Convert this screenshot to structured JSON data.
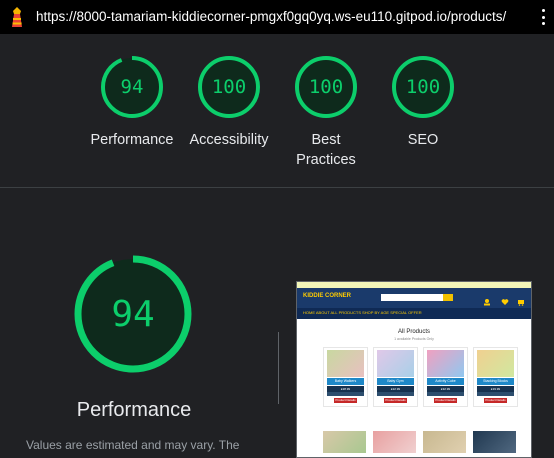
{
  "topbar": {
    "url": "https://8000-tamariam-kiddiecorner-pmgxf0gq0yq.ws-eu110.gitpod.io/products/"
  },
  "colors": {
    "good": "#0cce6b",
    "track": "#0a3a22",
    "background": "#202124"
  },
  "scores": [
    {
      "value": "94",
      "label": "Performance"
    },
    {
      "value": "100",
      "label": "Accessibility"
    },
    {
      "value": "100",
      "label": "Best Practices"
    },
    {
      "value": "100",
      "label": "SEO"
    }
  ],
  "main": {
    "score": "94",
    "title": "Performance",
    "disclaimer": "Values are estimated and may vary. The"
  },
  "screenshot": {
    "brand": "KIDDIE CORNER",
    "nav_links": "HOME  ABOUT  ALL PRODUCTS  SHOP BY AGE  SPECIAL OFFER",
    "heading": "All Products",
    "subheading": "1 available Products Only",
    "cards": [
      {
        "title": "Baby Walkers",
        "price": "£28.99",
        "button": "Product Details"
      },
      {
        "title": "Baby Gym",
        "price": "£22.99",
        "button": "Product Details"
      },
      {
        "title": "Activity Cube",
        "price": "£32.99",
        "button": "Product Details"
      },
      {
        "title": "Stacking Blocks",
        "price": "£19.99",
        "button": "Product Details"
      }
    ]
  }
}
